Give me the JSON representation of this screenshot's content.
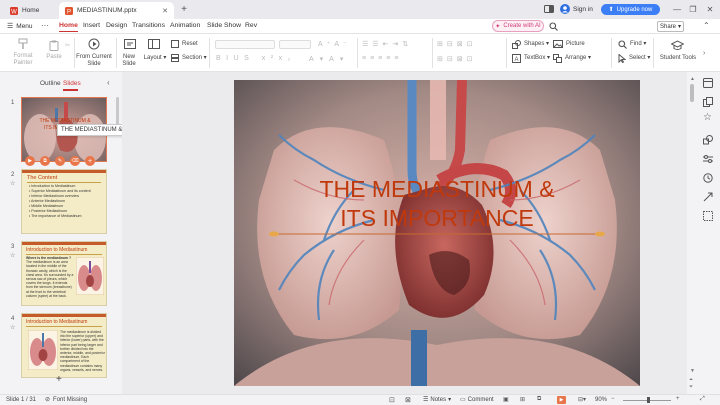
{
  "titlebar": {
    "home_tab": "Home",
    "doc_tab": "MEDIASTINUM.pptx",
    "signin": "Sign in",
    "upgrade": "Upgrade now"
  },
  "menubar": {
    "menu": "Menu",
    "items": [
      "Home",
      "Insert",
      "Design",
      "Transitions",
      "Animation",
      "Slide Show",
      "Rev"
    ],
    "create_ai": "Create with AI",
    "share": "Share"
  },
  "ribbon": {
    "format_painter": "Format\nPainter",
    "paste": "Paste",
    "from_current_slide": "From Current\nSlide",
    "new_slide": "New\nSlide",
    "layout": "Layout",
    "reset": "Reset",
    "section": "Section",
    "shapes": "Shapes",
    "picture": "Picture",
    "textbox": "TextBox",
    "arrange": "Arrange",
    "find": "Find",
    "select": "Select",
    "student_tools": "Student Tools"
  },
  "panel": {
    "outline_tab": "Outline",
    "slides_tab": "Slides",
    "tooltip": "THE MEDIASTINUM & ITS I..."
  },
  "slides": [
    {
      "num": "1",
      "title": "THE MEDIASTINUM & ITS IMPORTANCE"
    },
    {
      "num": "2",
      "title": "The Content",
      "bullets": [
        "Introduction to Mediastinum",
        "Superior Mediastinum and its content",
        "Inferior Mediastinum overview",
        "Anterior Mediastinum",
        "Middle Mediastinum",
        "Posterior Mediastinum",
        "The importance of Mediastinum"
      ]
    },
    {
      "num": "3",
      "title": "Introduction to Mediastinum",
      "subtitle": "Where is the mediastinum ?",
      "body": "The mediastinum is an area located in the middle of the thoracic cavity, which is the chest area. It's surrounded by a serous sac of pleura, which covers the lungs. It extends from the sternum (breastbone) at the front to the vertebral column (spine) at the back."
    },
    {
      "num": "4",
      "title": "Introduction to Mediastinum",
      "body": "The mediastinum is divided into the superior (upper) and inferior (lower) parts, with the inferior part being larger and further divided into the anterior, middle, and posterior mediastinum. Each compartment of the mediastinum contains many organs, vessels, and nerves."
    }
  ],
  "main_slide": {
    "title_line1": "THE MEDIASTINUM &",
    "title_line2": "ITS IMPORTANCE"
  },
  "status": {
    "slide_counter": "Slide 1 / 31",
    "font_missing": "Font Missing",
    "notes": "Notes",
    "comment": "Comment",
    "zoom": "90%"
  },
  "colors": {
    "accent": "#c43a2f",
    "title_text": "#c0390c",
    "upgrade": "#3b7ef5",
    "ai_button": "#e05088"
  }
}
